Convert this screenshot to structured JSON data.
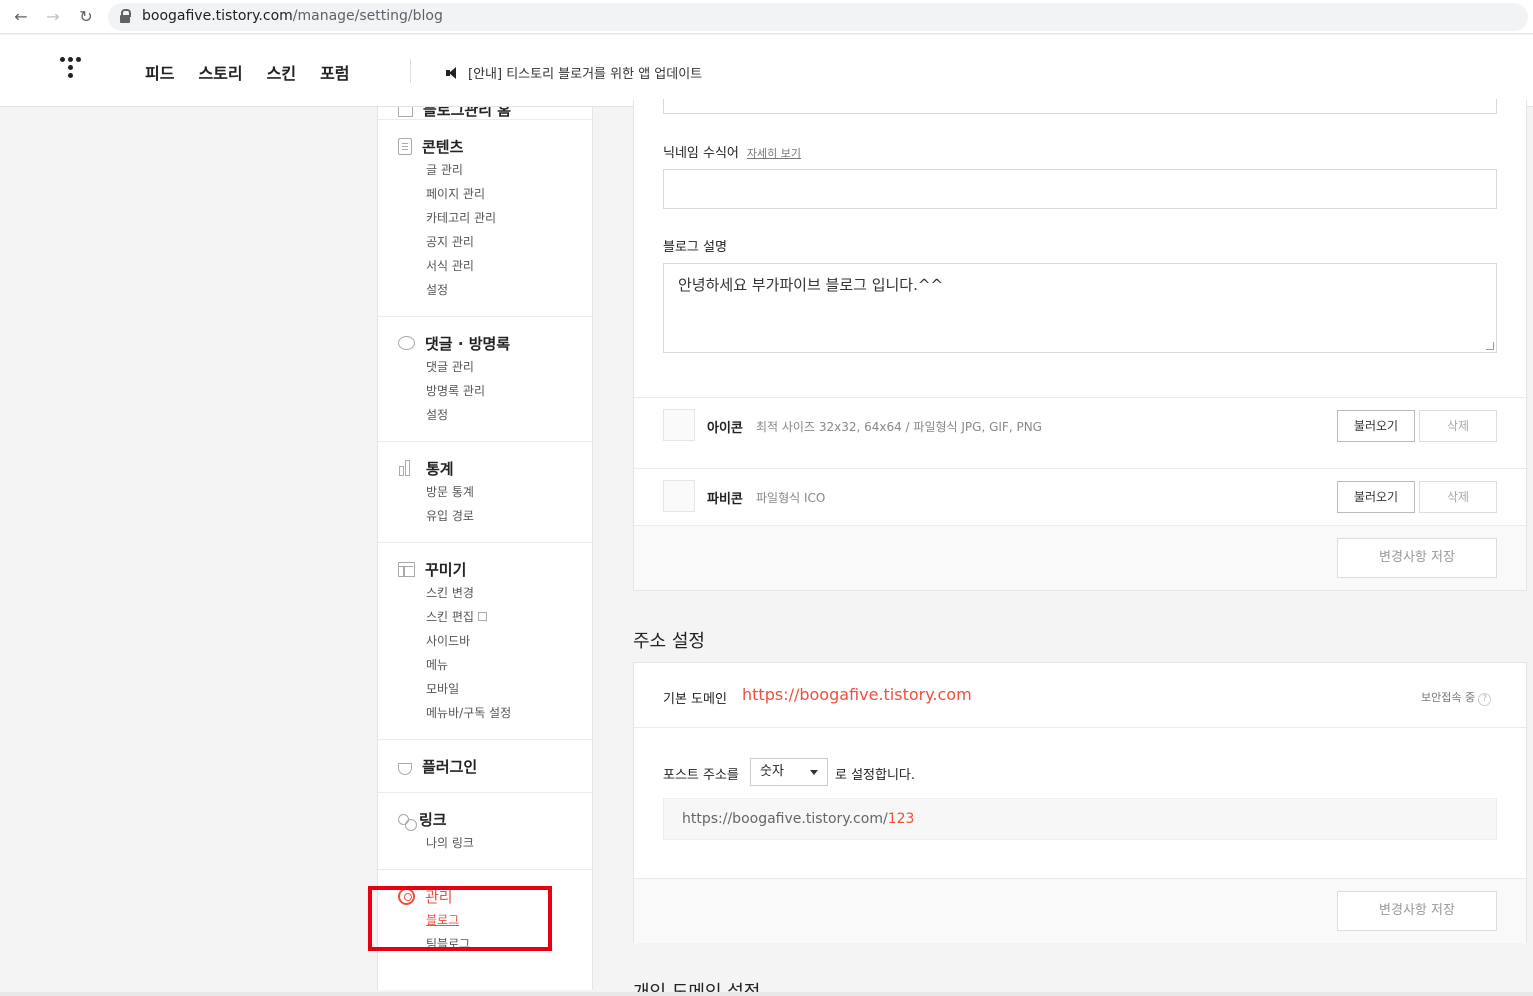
{
  "browser": {
    "url_host": "boogafive.tistory.com",
    "url_path": "/manage/setting/blog"
  },
  "topnav": {
    "menu": [
      "피드",
      "스토리",
      "스킨",
      "포럼"
    ],
    "notice": "[안내] 티스토리 블로거를 위한 앱 업데이트"
  },
  "sidebar": {
    "home_label": "블로그관리 홈",
    "groups": [
      {
        "title": "콘텐츠",
        "icon": "document-icon",
        "items": [
          "글 관리",
          "페이지 관리",
          "카테고리 관리",
          "공지 관리",
          "서식 관리",
          "설정"
        ]
      },
      {
        "title": "댓글 · 방명록",
        "icon": "comment-icon",
        "items": [
          "댓글 관리",
          "방명록 관리",
          "설정"
        ]
      },
      {
        "title": "통계",
        "icon": "chart-icon",
        "items": [
          "방문 통계",
          "유입 경로"
        ]
      },
      {
        "title": "꾸미기",
        "icon": "layout-icon",
        "items": [
          "스킨 변경",
          "스킨 편집",
          "사이드바",
          "메뉴",
          "모바일",
          "메뉴바/구독 설정"
        ]
      },
      {
        "title": "플러그인",
        "icon": "plugin-icon",
        "items": []
      },
      {
        "title": "링크",
        "icon": "link-icon",
        "items": [
          "나의 링크"
        ]
      },
      {
        "title": "관리",
        "icon": "gear-icon",
        "items": [
          "블로그",
          "팀블로그"
        ]
      }
    ],
    "accent_color": "#ef4f3c",
    "highlight_color": "#e60012"
  },
  "blog_settings": {
    "nickname_label": "닉네임 수식어",
    "nickname_link": "자세히 보기",
    "nickname_value": "",
    "description_label": "블로그 설명",
    "description_value": "안녕하세요 부가파이브 블로그 입니다.^^",
    "icon_label": "아이콘",
    "icon_desc": "최적 사이즈 32x32, 64x64 / 파일형식 JPG, GIF, PNG",
    "favicon_label": "파비콘",
    "favicon_desc": "파일형식 ICO",
    "load_button": "불러오기",
    "delete_button": "삭제",
    "save_button": "변경사항 저장"
  },
  "address_settings": {
    "title": "주소 설정",
    "domain_label": "기본 도메인",
    "domain_url": "https://boogafive.tistory.com",
    "secure_label": "보안접속 중",
    "help_glyph": "?",
    "post_address_label": "포스트 주소를",
    "post_address_select": "숫자",
    "post_address_suffix": "로 설정합니다.",
    "preview_base": "https://boogafive.tistory.com/",
    "preview_num": "123",
    "save_button": "변경사항 저장"
  },
  "next_section_title": "개인 도메인 설정"
}
